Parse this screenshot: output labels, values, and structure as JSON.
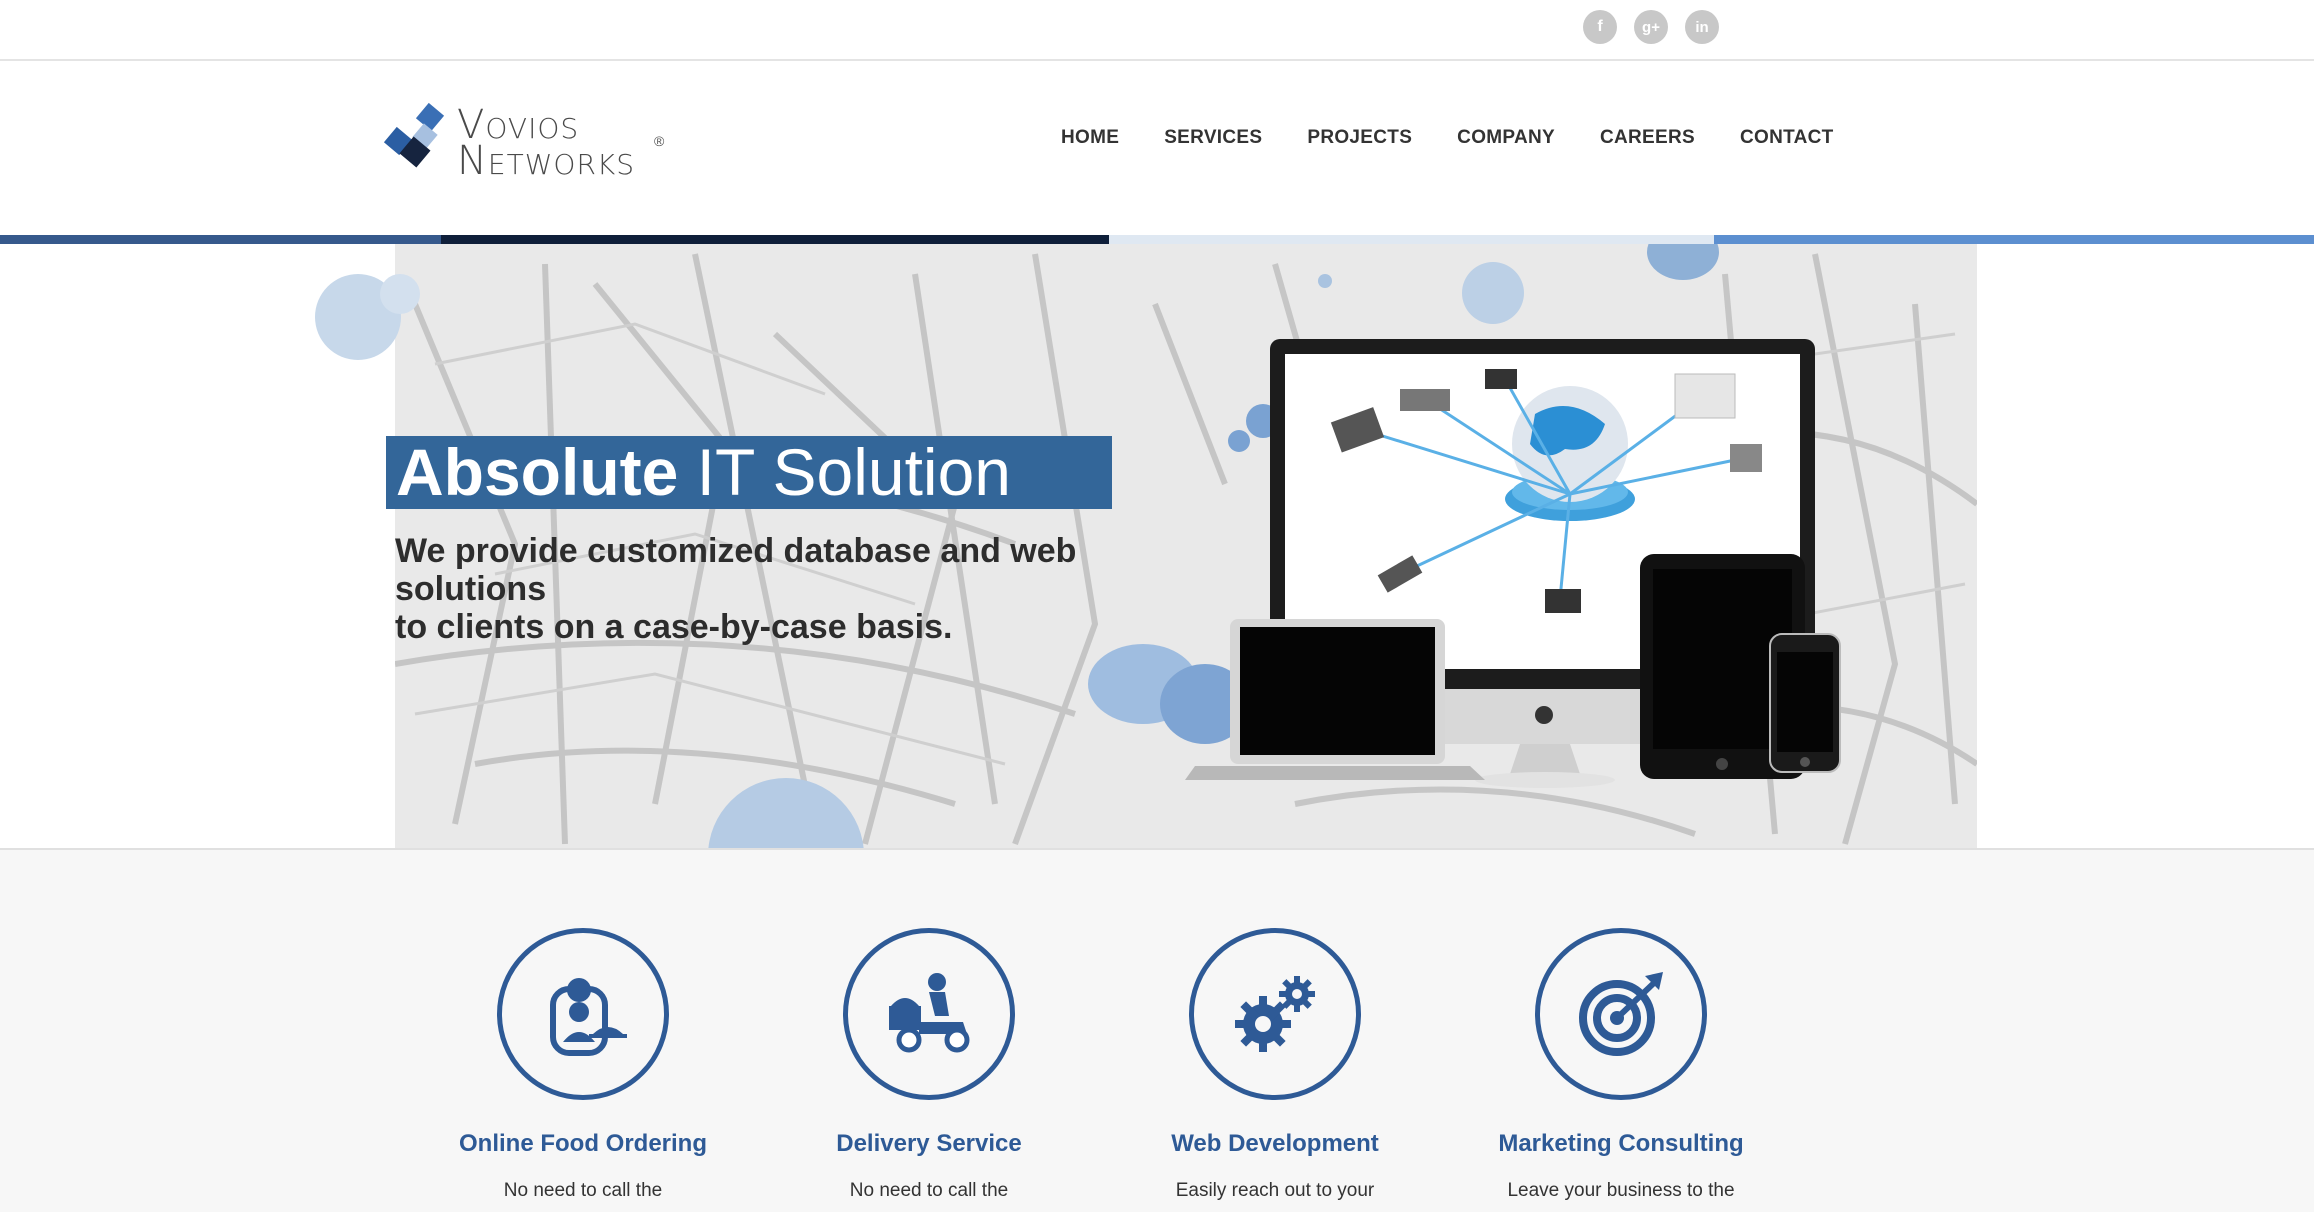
{
  "social": {
    "facebook": "f",
    "google_plus": "g+",
    "linkedin": "in"
  },
  "logo": {
    "line1": "Vovios",
    "line2": "Networks",
    "registered": "®"
  },
  "nav": {
    "items": [
      "HOME",
      "SERVICES",
      "PROJECTS",
      "COMPANY",
      "CAREERS",
      "CONTACT"
    ]
  },
  "hero": {
    "title_bold": "Absolute",
    "title_rest": " IT Solution",
    "subtitle_line1": "We provide customized database and web solutions",
    "subtitle_line2": "to clients on a case-by-case basis."
  },
  "services": [
    {
      "title": "Online Food Ordering",
      "text": "No need to call the",
      "icon": "chef-serving-icon"
    },
    {
      "title": "Delivery Service",
      "text": "No need to call the",
      "icon": "delivery-scooter-icon"
    },
    {
      "title": "Web Development",
      "text": "Easily reach out to your",
      "icon": "gears-icon"
    },
    {
      "title": "Marketing Consulting",
      "text": "Leave your business to the",
      "icon": "target-icon"
    }
  ],
  "colors": {
    "brand_blue": "#336699",
    "service_blue": "#2e5a96",
    "stripe": [
      "#36598c",
      "#0f1f3a",
      "#dfe8f2",
      "#5c8fd0"
    ]
  }
}
